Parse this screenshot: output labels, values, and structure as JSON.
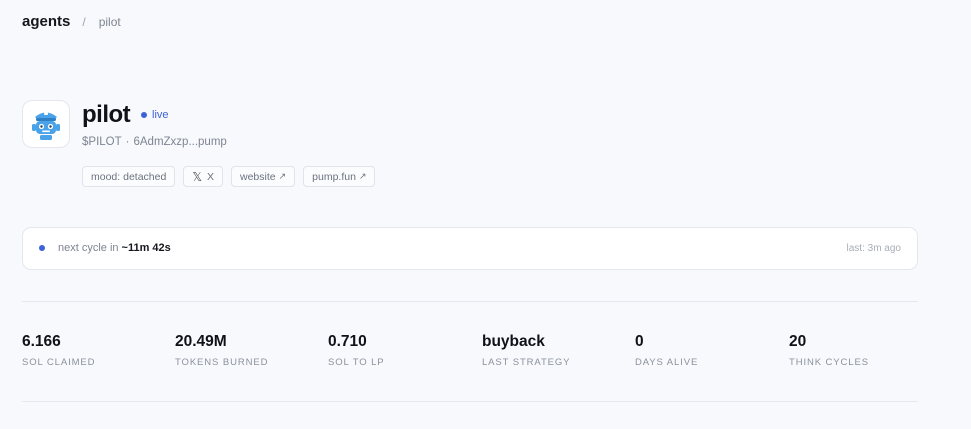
{
  "breadcrumb": {
    "root": "agents",
    "separator": "/",
    "current": "pilot"
  },
  "agent": {
    "name": "pilot",
    "status": "live",
    "ticker": "$PILOT",
    "meta_separator": "·",
    "address": "6AdmZxzp...pump",
    "avatar_icon": "robot-pilot-icon"
  },
  "chips": {
    "mood": "mood: detached",
    "x": "X",
    "website": "website",
    "pumpfun": "pump.fun",
    "external_arrow": "↗"
  },
  "cycle": {
    "prefix": "next cycle in",
    "countdown": "~11m 42s",
    "last": "last: 3m ago"
  },
  "stats": [
    {
      "value": "6.166",
      "label": "SOL CLAIMED"
    },
    {
      "value": "20.49M",
      "label": "TOKENS BURNED"
    },
    {
      "value": "0.710",
      "label": "SOL TO LP"
    },
    {
      "value": "buyback",
      "label": "LAST STRATEGY"
    },
    {
      "value": "0",
      "label": "DAYS ALIVE"
    },
    {
      "value": "20",
      "label": "THINK CYCLES"
    }
  ],
  "colors": {
    "accent": "#3d63d6",
    "background": "#f8f9fc",
    "avatar_blue": "#4aa3e8"
  }
}
